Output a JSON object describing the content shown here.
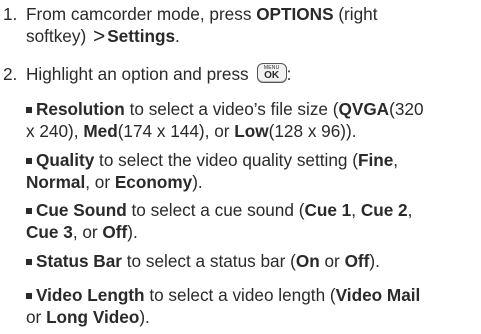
{
  "steps": [
    {
      "num": "1.",
      "line1": {
        "t1": "From camcorder mode, press ",
        "b1": "OPTIONS",
        "t2": " (right"
      },
      "line2": {
        "t1": "softkey) ",
        "gt": ">",
        "b1": "Settings",
        "t2": "."
      }
    },
    {
      "num": "2.",
      "text": "Highlight an option and press",
      "key_top": "MENU",
      "key_main": "OK",
      "after": ":"
    }
  ],
  "options": [
    {
      "name": "Resolution",
      "l1": {
        "t1": " to select a video’s file size (",
        "b1": "QVGA",
        "t2": "(320"
      },
      "l2": {
        "t1": "x 240), ",
        "b1": "Med",
        "t2": "(174 x 144), or ",
        "b2": "Low",
        "t3": "(128 x 96))."
      }
    },
    {
      "name": "Quality",
      "l1": {
        "t1": " to select the video quality setting (",
        "b1": "Fine",
        "t2": ","
      },
      "l2": {
        "b1": "Normal",
        "t1": ", or ",
        "b2": "Economy",
        "t2": ")."
      }
    },
    {
      "name": "Cue Sound",
      "l1": {
        "t1": " to select a cue sound (",
        "b1": "Cue 1",
        "t2": ", ",
        "b2": "Cue 2",
        "t3": ","
      },
      "l2": {
        "b1": "Cue 3",
        "t1": ", or ",
        "b2": "Off",
        "t2": ")."
      }
    },
    {
      "name": "Status Bar",
      "l1": {
        "t1": " to select a status bar (",
        "b1": "On",
        "t2": " or ",
        "b2": "Off",
        "t3": ")."
      }
    },
    {
      "name": "Video Length",
      "l1": {
        "t1": " to select a video length (",
        "b1": "Video Mail",
        "t2": ""
      },
      "l2": {
        "t1": "or ",
        "b1": "Long Video",
        "t2": ")."
      }
    }
  ]
}
